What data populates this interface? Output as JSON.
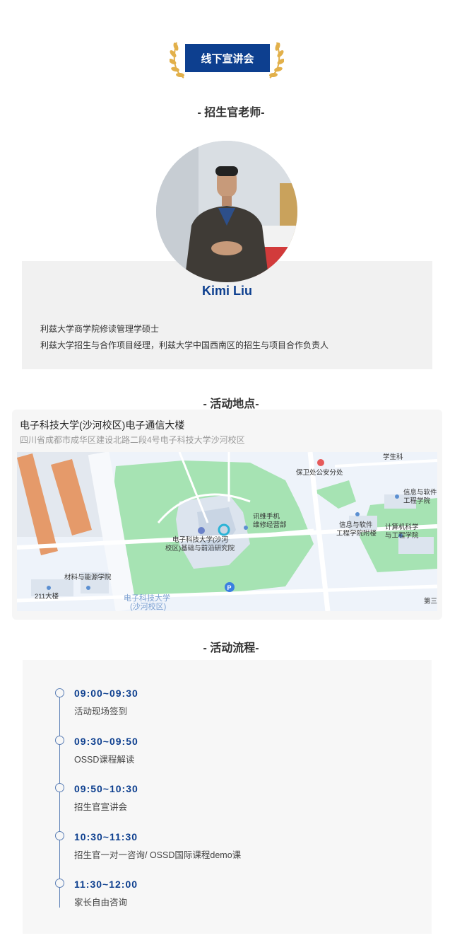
{
  "header": {
    "badge_label": "线下宣讲会"
  },
  "teacher_section": {
    "title": "- 招生官老师-",
    "name": "Kimi Liu",
    "lines": [
      "利兹大学商学院修读管理学硕士",
      "利兹大学招生与合作项目经理，利兹大学中国西南区的招生与项目合作负责人"
    ]
  },
  "location_section": {
    "title": "- 活动地点-",
    "place_name": "电子科技大学(沙河校区)电子通信大楼",
    "address": "四川省成都市成华区建设北路二段4号电子科技大学沙河校区",
    "map_labels": {
      "student_section": "学生科",
      "security_office": "保卫处公安分处",
      "info_software_1": "信息与软件",
      "info_software_2": "工程学院",
      "xunwei_1": "讯维手机",
      "xunwei_2": "维修经营部",
      "uestc_poi_1": "电子科技大学(沙河",
      "uestc_poi_2": "校区)基础与前沿研究院",
      "info_annex_1": "信息与软件",
      "info_annex_2": "工程学院附楼",
      "cs_1": "计算机科学",
      "cs_2": "与工程学院",
      "materials": "材料与能源学院",
      "bldg_211": "211大楼",
      "campus_1": "电子科技大学",
      "campus_2": "(沙河校区)",
      "third": "第三"
    }
  },
  "schedule_section": {
    "title": "- 活动流程-",
    "items": [
      {
        "time": "09:00~09:30",
        "desc": "活动现场签到"
      },
      {
        "time": "09:30~09:50",
        "desc": "OSSD课程解读"
      },
      {
        "time": "09:50~10:30",
        "desc": "招生官宣讲会"
      },
      {
        "time": "10:30~11:30",
        "desc": "招生官一对一咨询/ OSSD国际课程demo课"
      },
      {
        "time": "11:30~12:00",
        "desc": "家长自由咨询"
      }
    ]
  },
  "colors": {
    "brand_blue": "#0d3f8f",
    "card_gray": "#f1f1f1",
    "laurel_gold": "#e2b04a",
    "map_green": "#a6e3b3"
  }
}
